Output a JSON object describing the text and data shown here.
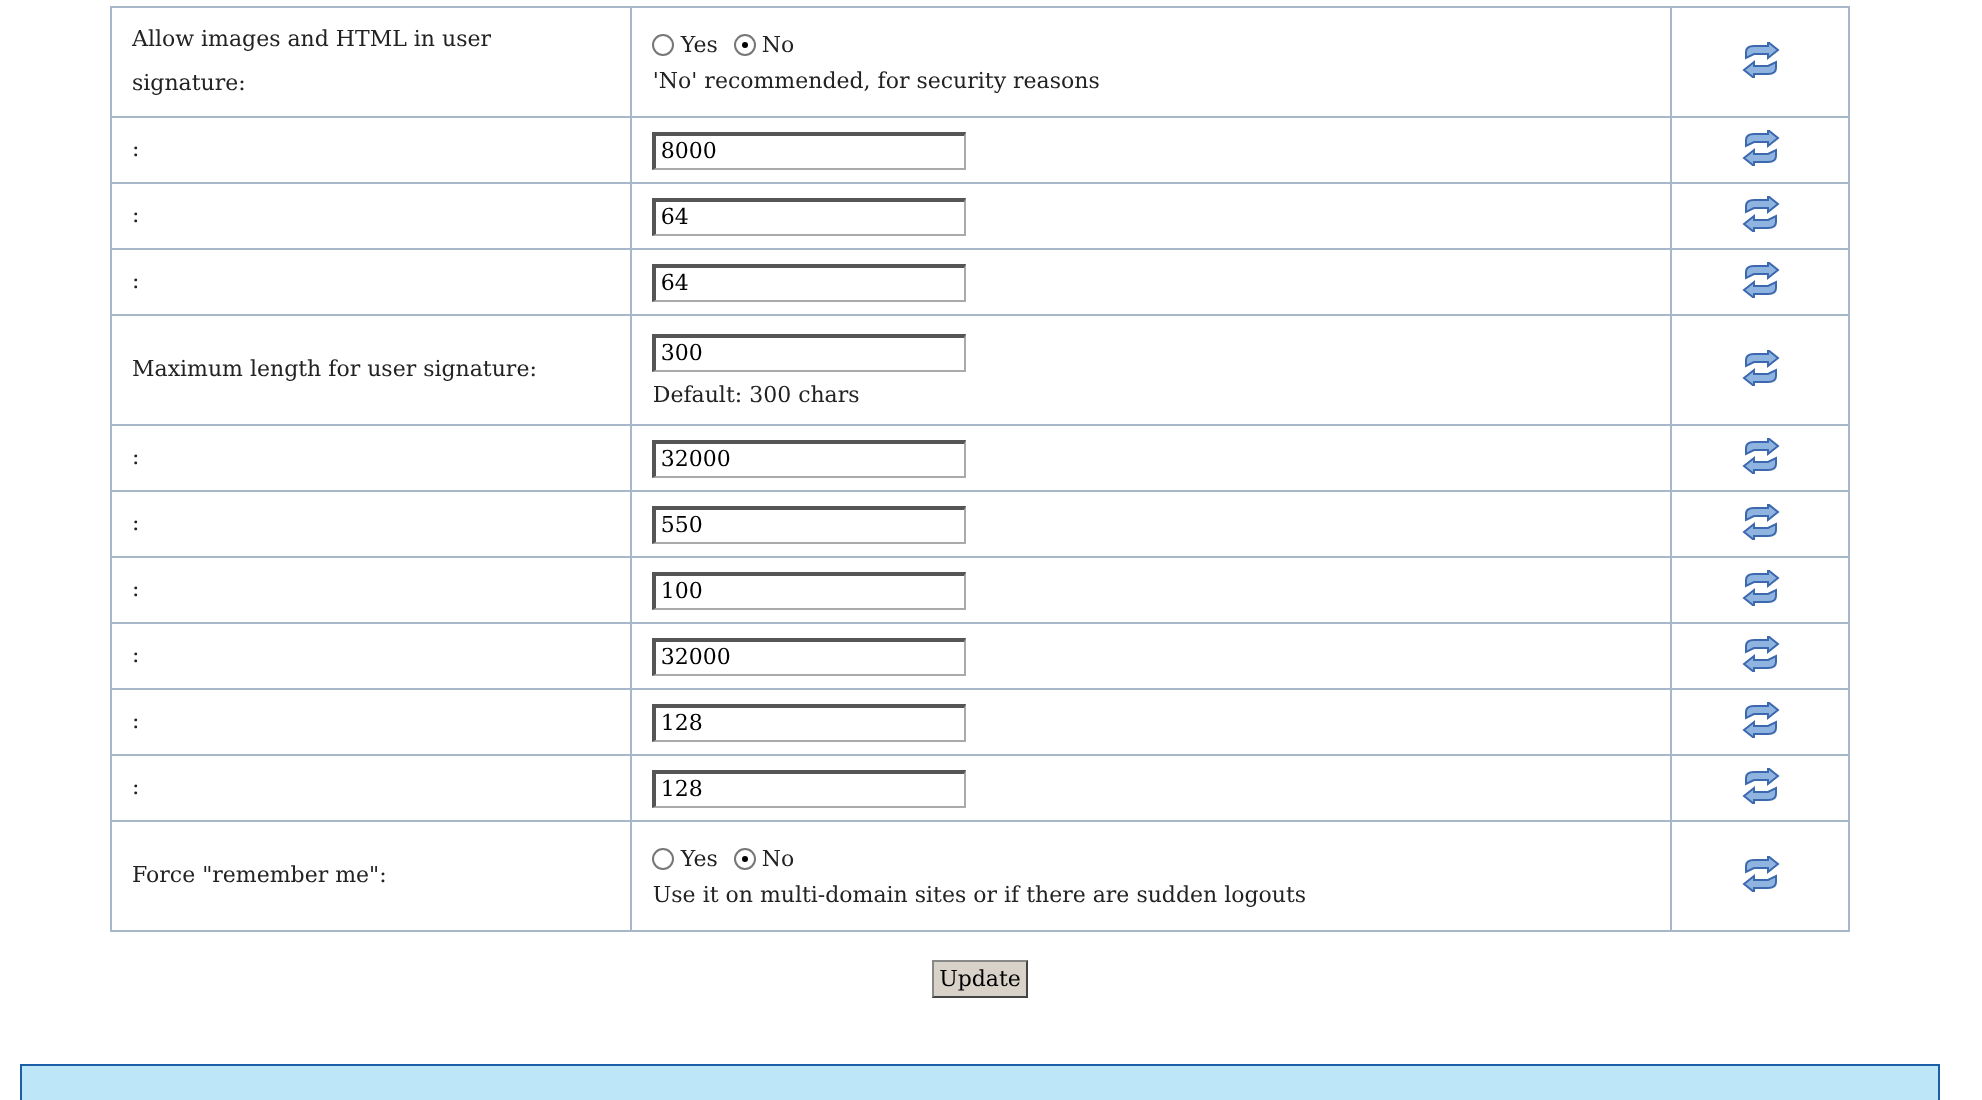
{
  "settings": [
    {
      "kind": "radio",
      "label": "Allow images and HTML in user signature:",
      "options": [
        {
          "label": "Yes",
          "selected": false
        },
        {
          "label": "No",
          "selected": true
        }
      ],
      "note": "'No' recommended, for security reasons"
    },
    {
      "kind": "input",
      "label": ":",
      "value": "8000"
    },
    {
      "kind": "input",
      "label": ":",
      "value": "64"
    },
    {
      "kind": "input",
      "label": ":",
      "value": "64"
    },
    {
      "kind": "input",
      "label": "Maximum length for user signature:",
      "value": "300",
      "note": "Default: 300 chars"
    },
    {
      "kind": "input",
      "label": ":",
      "value": "32000"
    },
    {
      "kind": "input",
      "label": ":",
      "value": "550"
    },
    {
      "kind": "input",
      "label": ":",
      "value": "100"
    },
    {
      "kind": "input",
      "label": ":",
      "value": "32000"
    },
    {
      "kind": "input",
      "label": ":",
      "value": "128"
    },
    {
      "kind": "input",
      "label": ":",
      "value": "128"
    },
    {
      "kind": "radio",
      "label": "Force \"remember me\":",
      "options": [
        {
          "label": "Yes",
          "selected": false
        },
        {
          "label": "No",
          "selected": true
        }
      ],
      "note": "Use it on multi-domain sites or if there are sudden logouts"
    }
  ],
  "update_button": "Update"
}
